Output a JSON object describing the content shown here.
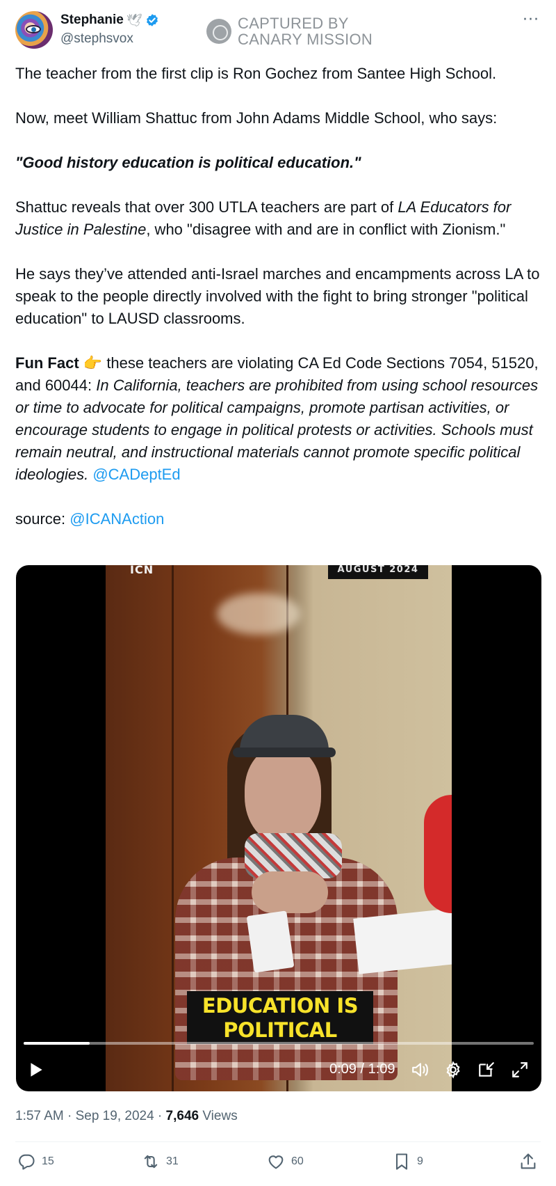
{
  "author": {
    "display_name": "Stephanie",
    "handle": "@stephsvox",
    "name_emoji": "🕊",
    "verified": true
  },
  "watermark": {
    "line1": "CAPTURED BY",
    "line2": "CANARY MISSION"
  },
  "more_label": "···",
  "tweet": {
    "p1": "The teacher from the first clip is Ron Gochez from Santee High School.",
    "p2": "Now, meet William Shattuc from John Adams Middle School, who says:",
    "p3_quote": "\"Good history education is political education.\"",
    "p4_a": "Shattuc reveals that over 300 UTLA teachers are part of ",
    "p4_italic": "LA Educators for Justice in Palestine",
    "p4_b": ", who \"disagree with and are in conflict with Zionism.\"",
    "p5": "He says they’ve attended anti-Israel marches and encampments across LA to speak to the people directly involved with the fight to bring stronger \"political education\" to LAUSD classrooms.",
    "p6_bold": "Fun Fact",
    "p6_emoji": "👉",
    "p6_a": " these teachers are violating CA Ed Code Sections 7054, 51520, and 60044: ",
    "p6_italic": "In California, teachers are prohibited from using school resources or time to advocate for political campaigns, promote partisan activities, or encourage students to engage in political protests or activities. Schools must remain neutral, and instructional materials cannot promote specific political ideologies.",
    "p6_link": "@CADeptEd",
    "p7_label": "source: ",
    "p7_link": "@ICANAction"
  },
  "video": {
    "top_tag": "AUGUST 2024",
    "logo_text": "ICN",
    "caption_line1": "EDUCATION IS",
    "caption_line2": "POLITICAL",
    "time_display": "0:09 / 1:09",
    "progress": 0.13
  },
  "meta": {
    "time_date": "1:57 AM · Sep 19, 2024 · ",
    "views_count": "7,646",
    "views_label": " Views"
  },
  "actions": {
    "replies": "15",
    "reposts": "31",
    "likes": "60",
    "bookmarks": "9"
  },
  "colors": {
    "link": "#1d9bf0",
    "secondary_text": "#536471",
    "caption_text": "#f7e22a"
  }
}
